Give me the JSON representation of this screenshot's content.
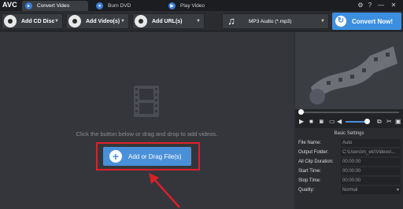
{
  "app": {
    "logo": "AVC"
  },
  "tabs": [
    {
      "label": "Convert Video"
    },
    {
      "label": "Burn DVD"
    },
    {
      "label": "Play Video"
    }
  ],
  "window_controls": {
    "settings": "⚙",
    "help": "?",
    "minimize": "—",
    "close": "✕"
  },
  "toolbar": {
    "add_cd": "Add CD Disc",
    "add_video": "Add Video(s)",
    "add_url": "Add URL(s)",
    "format": "MP3 Audio (*.mp3)",
    "convert": "Convert Now!"
  },
  "main": {
    "hint": "Click the button below or drag and drop to add videos.",
    "add_button": "Add or Drag File(s)"
  },
  "colors": {
    "accent": "#3c8fe0",
    "highlight": "#e0202a"
  },
  "basic_settings": {
    "title": "Basic Settings",
    "rows": [
      {
        "label": "File Name:",
        "value": "Auto"
      },
      {
        "label": "Output Folder:",
        "value": "C:\\Users\\m_elc\\Videos\\..."
      },
      {
        "label": "All Clip Duration:",
        "value": "00:00:00"
      },
      {
        "label": "Start Time:",
        "value": "00:00:00"
      },
      {
        "label": "Stop Time:",
        "value": "00:00:00"
      },
      {
        "label": "Quality:",
        "value": "Normal"
      }
    ]
  }
}
